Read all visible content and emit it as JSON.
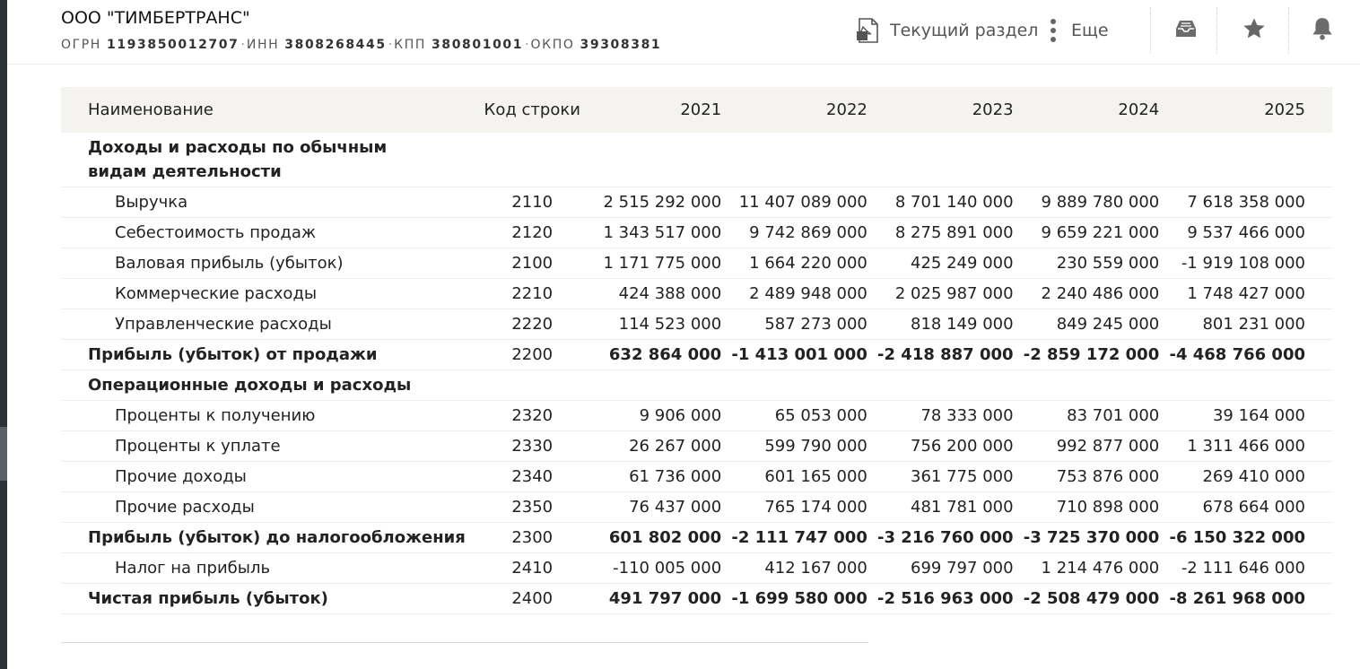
{
  "company": {
    "name": "ООО \"ТИМБЕРТРАНС\"",
    "ogrn_label": "ОГРН",
    "ogrn": "1193850012707",
    "inn_label": "ИНН",
    "inn": "3808268445",
    "kpp_label": "КПП",
    "kpp": "380801001",
    "okpo_label": "ОКПО",
    "okpo": "39308381",
    "separator": "·"
  },
  "toolbar": {
    "current_section_label": "Текущий раздел",
    "more_label": "Еще",
    "icons": [
      "pdf-icon",
      "more-vertical-icon",
      "inbox-icon",
      "star-icon",
      "bell-icon"
    ]
  },
  "table": {
    "headers": {
      "name": "Наименование",
      "code": "Код строки",
      "years": [
        "2021",
        "2022",
        "2023",
        "2024",
        "2025"
      ]
    },
    "section1": {
      "title": "Доходы и расходы по обычным видам деятельности"
    },
    "rows": [
      {
        "name": "Выручка",
        "code": "2110",
        "values": [
          "2 515 292 000",
          "11 407 089 000",
          "8 701 140 000",
          "9 889 780 000",
          "7 618 358 000"
        ]
      },
      {
        "name": "Себестоимость продаж",
        "code": "2120",
        "values": [
          "1 343 517 000",
          "9 742 869 000",
          "8 275 891 000",
          "9 659 221 000",
          "9 537 466 000"
        ]
      },
      {
        "name": "Валовая прибыль (убыток)",
        "code": "2100",
        "values": [
          "1 171 775 000",
          "1 664 220 000",
          "425 249 000",
          "230 559 000",
          "-1 919 108 000"
        ]
      },
      {
        "name": "Коммерческие расходы",
        "code": "2210",
        "values": [
          "424 388 000",
          "2 489 948 000",
          "2 025 987 000",
          "2 240 486 000",
          "1 748 427 000"
        ]
      },
      {
        "name": "Управленческие расходы",
        "code": "2220",
        "values": [
          "114 523 000",
          "587 273 000",
          "818 149 000",
          "849 245 000",
          "801 231 000"
        ]
      },
      {
        "name": "Прибыль (убыток) от продажи",
        "code": "2200",
        "values": [
          "632 864 000",
          "-1 413 001 000",
          "-2 418 887 000",
          "-2 859 172 000",
          "-4 468 766 000"
        ]
      },
      {
        "name": "Операционные доходы и расходы"
      },
      {
        "name": "Проценты к получению",
        "code": "2320",
        "values": [
          "9 906 000",
          "65 053 000",
          "78 333 000",
          "83 701 000",
          "39 164 000"
        ]
      },
      {
        "name": "Проценты к уплате",
        "code": "2330",
        "values": [
          "26 267 000",
          "599 790 000",
          "756 200 000",
          "992 877 000",
          "1 311 466 000"
        ]
      },
      {
        "name": "Прочие доходы",
        "code": "2340",
        "values": [
          "61 736 000",
          "601 165 000",
          "361 775 000",
          "753 876 000",
          "269 410 000"
        ]
      },
      {
        "name": "Прочие расходы",
        "code": "2350",
        "values": [
          "76 437 000",
          "765 174 000",
          "481 781 000",
          "710 898 000",
          "678 664 000"
        ]
      },
      {
        "name": "Прибыль (убыток) до налогообложения",
        "code": "2300",
        "values": [
          "601 802 000",
          "-2 111 747 000",
          "-3 216 760 000",
          "-3 725 370 000",
          "-6 150 322 000"
        ]
      },
      {
        "name": "Налог на прибыль",
        "code": "2410",
        "values": [
          "-110 005 000",
          "412 167 000",
          "699 797 000",
          "1 214 476 000",
          "-2 111 646 000"
        ]
      },
      {
        "name": "Чистая прибыль (убыток)",
        "code": "2400",
        "values": [
          "491 797 000",
          "-1 699 580 000",
          "-2 516 963 000",
          "-2 508 479 000",
          "-8 261 968 000"
        ]
      }
    ]
  },
  "colors": {
    "sidebar": "#2e3138",
    "header_row_bg": "#f4f3f0",
    "row_border": "#ececec",
    "text": "#222222",
    "muted": "#555555"
  }
}
